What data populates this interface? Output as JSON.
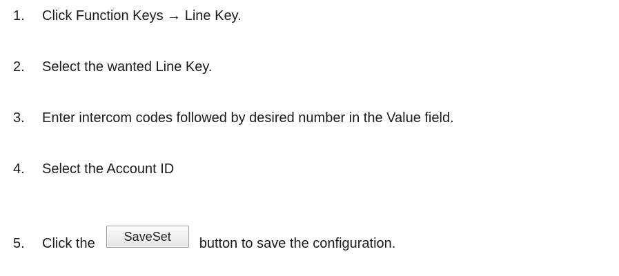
{
  "steps": [
    {
      "num": "1.",
      "text": "Click Function Keys → Line Key."
    },
    {
      "num": "2.",
      "text": "Select the wanted Line Key."
    },
    {
      "num": "3.",
      "text": "Enter intercom codes followed by desired number in the Value field."
    },
    {
      "num": "4.",
      "text": "Select the Account ID"
    },
    {
      "num": "5.",
      "text_before": "Click the",
      "button_label": "SaveSet",
      "text_after": "button to save the configuration."
    }
  ]
}
